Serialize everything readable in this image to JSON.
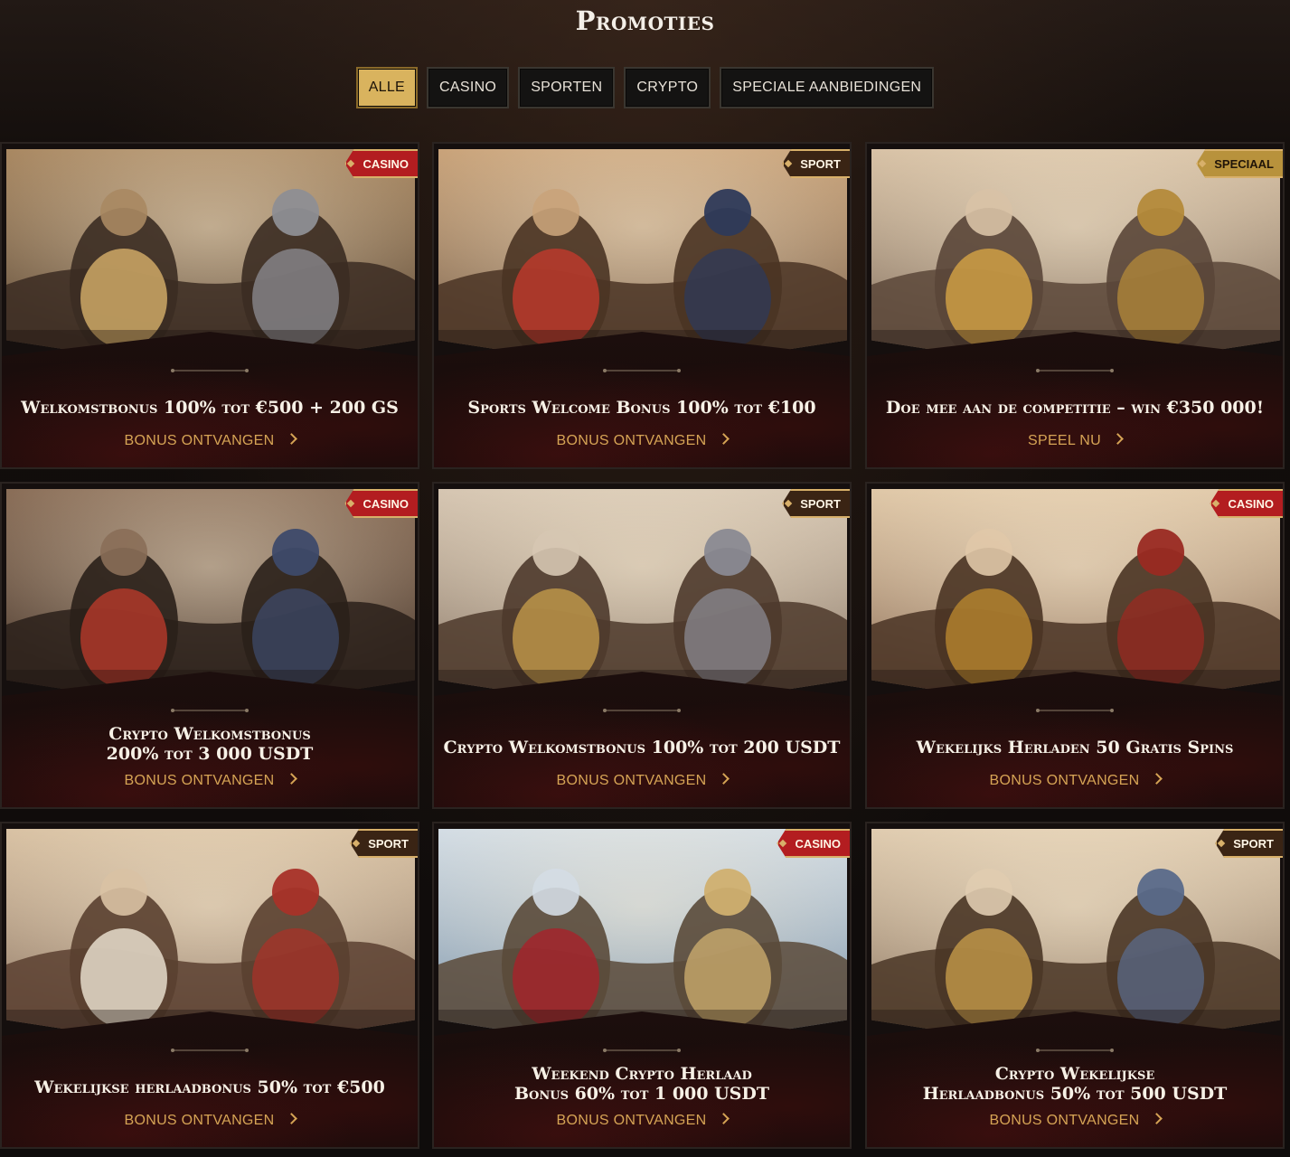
{
  "page": {
    "title": "Promoties"
  },
  "filters": [
    {
      "label": "Alle",
      "active": true
    },
    {
      "label": "Casino",
      "active": false
    },
    {
      "label": "Sporten",
      "active": false
    },
    {
      "label": "Crypto",
      "active": false
    },
    {
      "label": "Speciale aanbiedingen",
      "active": false
    }
  ],
  "promotions": [
    {
      "badge": "Casino",
      "title_lines": [
        "Welkomstbonus 100% tot €500 + 200 GS"
      ],
      "cta": "Bonus ontvangen",
      "image": "caesar-vs-centurion"
    },
    {
      "badge": "Sport",
      "title_lines": [
        "Sports Welcome Bonus 100% tot €100"
      ],
      "cta": "Bonus ontvangen",
      "image": "gladiators-fighting"
    },
    {
      "badge": "Speciaal",
      "title_lines": [
        "Doe mee aan de competitie – win €350 000!"
      ],
      "cta": "Speel nu",
      "image": "golden-trophy-colosseum"
    },
    {
      "badge": "Casino",
      "title_lines": [
        "Crypto Welkomstbonus",
        "200% tot 3 000 USDT"
      ],
      "cta": "Bonus ontvangen",
      "image": "crypto-flag-warriors"
    },
    {
      "badge": "Sport",
      "title_lines": [
        "Crypto Welkomstbonus 100% tot 200 USDT"
      ],
      "cta": "Bonus ontvangen",
      "image": "bitcoin-ethereum-shields"
    },
    {
      "badge": "Casino",
      "title_lines": [
        "Wekelijks Herladen 50 Gratis Spins"
      ],
      "cta": "Bonus ontvangen",
      "image": "emperor-army-gold"
    },
    {
      "badge": "Sport",
      "title_lines": [
        "Wekelijkse herlaadbonus 50% tot €500"
      ],
      "cta": "Bonus ontvangen",
      "image": "laurel-crowning"
    },
    {
      "badge": "Casino",
      "title_lines": [
        "Weekend Crypto Herlaad",
        "Bonus 60% tot 1 000 USDT"
      ],
      "cta": "Bonus ontvangen",
      "image": "emperor-throne-flags"
    },
    {
      "badge": "Sport",
      "title_lines": [
        "Crypto Wekelijkse",
        "Herlaadbonus 50% tot 500 USDT"
      ],
      "cta": "Bonus ontvangen",
      "image": "gladiators-crypto-shields"
    }
  ],
  "colors": {
    "accent_gold": "#d6a455",
    "active_filter": "#d9b35e",
    "badge_casino": "#b31d20",
    "badge_sport": "#3a2414",
    "badge_special": "#b8923c"
  }
}
